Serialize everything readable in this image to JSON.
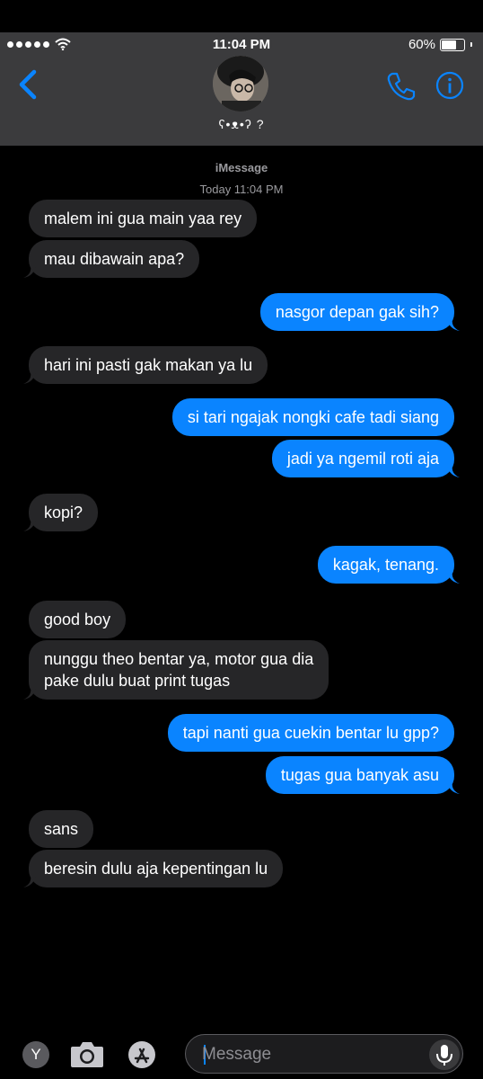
{
  "status_bar": {
    "time": "11:04 PM",
    "battery": "60%"
  },
  "header": {
    "contact_name": "ʕ•ᴥ•ʔ ?"
  },
  "conversation": {
    "service": "iMessage",
    "timestamp": "Today 11:04 PM"
  },
  "messages": [
    {
      "side": "received",
      "text": "malem ini gua main yaa rey"
    },
    {
      "side": "received",
      "text": "mau dibawain apa?"
    },
    {
      "side": "sent",
      "text": "nasgor depan gak sih?"
    },
    {
      "side": "received",
      "text": "hari ini pasti gak makan ya lu"
    },
    {
      "side": "sent",
      "text": "si tari ngajak nongki cafe tadi siang"
    },
    {
      "side": "sent",
      "text": "jadi ya ngemil roti aja"
    },
    {
      "side": "received",
      "text": "kopi?"
    },
    {
      "side": "sent",
      "text": "kagak, tenang."
    },
    {
      "side": "received",
      "text": "good boy"
    },
    {
      "side": "received",
      "text": "nunggu theo bentar ya, motor gua dia"
    },
    {
      "side": "received",
      "text": "pake dulu buat print tugas"
    },
    {
      "side": "sent",
      "text": "tapi nanti gua cuekin bentar lu gpp?"
    },
    {
      "side": "sent",
      "text": "tugas gua banyak asu"
    },
    {
      "side": "received",
      "text": "sans"
    },
    {
      "side": "received",
      "text": "beresin dulu aja kepentingan lu"
    }
  ],
  "composer": {
    "placeholder": "Message",
    "app_letter": "Y"
  },
  "colors": {
    "sent_bubble": "#0a84ff",
    "received_bubble": "#262628",
    "accent": "#0a84ff",
    "header_bg": "#3b3b3d"
  },
  "icons": [
    "back-chevron-icon",
    "phone-icon",
    "info-icon",
    "camera-icon",
    "app-store-icon",
    "microphone-icon",
    "wifi-icon",
    "battery-icon"
  ]
}
